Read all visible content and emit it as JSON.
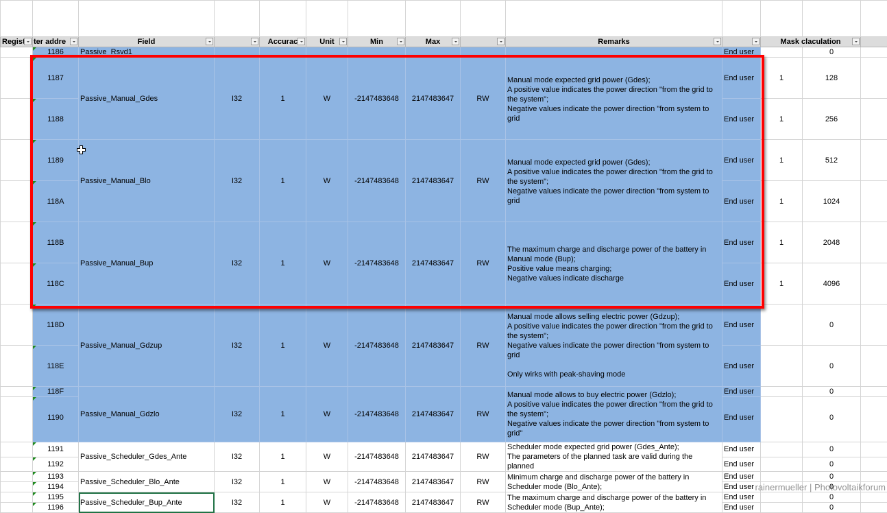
{
  "headers": [
    "Registe",
    "ter addre",
    "Field",
    "",
    "Accurac",
    "Unit",
    "Min",
    "Max",
    "",
    "Remarks",
    "",
    "Mask claculation"
  ],
  "groups": [
    {
      "field": "Passive_Rsvd1",
      "type": "",
      "acc": "",
      "unit": "",
      "min": "",
      "max": "",
      "rw": "",
      "remarks": "",
      "rows": [
        {
          "addr": "1186",
          "user": "End user",
          "m1": "",
          "m2": "0"
        }
      ]
    },
    {
      "field": "Passive_Manual_Gdes",
      "type": "I32",
      "acc": "1",
      "unit": "W",
      "min": "-2147483648",
      "max": "2147483647",
      "rw": "RW",
      "remarks": "Manual mode expected grid power (Gdes);\nA positive value indicates the power direction \"from the grid to the system\";\nNegative values indicate the power direction \"from system to grid",
      "rows": [
        {
          "addr": "1187",
          "user": "End user",
          "m1": "1",
          "m2": "128"
        },
        {
          "addr": "1188",
          "user": "End user",
          "m1": "1",
          "m2": "256"
        }
      ]
    },
    {
      "field": "Passive_Manual_Blo",
      "type": "I32",
      "acc": "1",
      "unit": "W",
      "min": "-2147483648",
      "max": "2147483647",
      "rw": "RW",
      "remarks": "Manual mode expected grid power (Gdes);\nA positive value indicates the power direction \"from the grid to the system\";\nNegative values indicate the power direction \"from system to grid",
      "rows": [
        {
          "addr": "1189",
          "user": "End user",
          "m1": "1",
          "m2": "512"
        },
        {
          "addr": "118A",
          "user": "End user",
          "m1": "1",
          "m2": "1024"
        }
      ]
    },
    {
      "field": "Passive_Manual_Bup",
      "type": "I32",
      "acc": "1",
      "unit": "W",
      "min": "-2147483648",
      "max": "2147483647",
      "rw": "RW",
      "remarks": "The maximum charge and discharge power of the battery in Manual mode (Bup);\nPositive value means charging;\nNegative values indicate discharge",
      "rows": [
        {
          "addr": "118B",
          "user": "End user",
          "m1": "1",
          "m2": "2048"
        },
        {
          "addr": "118C",
          "user": "End user",
          "m1": "1",
          "m2": "4096"
        }
      ]
    },
    {
      "field": "Passive_Manual_Gdzup",
      "type": "I32",
      "acc": "1",
      "unit": "W",
      "min": "-2147483648",
      "max": "2147483647",
      "rw": "RW",
      "remarks": "Manual mode allows selling electric power (Gdzup);\nA positive value indicates the power direction \"from the grid to the system\";\nNegative values indicate the power direction \"from system to grid\n\nOnly wirks with peak-shaving mode",
      "rows": [
        {
          "addr": "118D",
          "user": "End user",
          "m1": "",
          "m2": "0"
        },
        {
          "addr": "118E",
          "user": "End user",
          "m1": "",
          "m2": "0"
        }
      ]
    },
    {
      "field": "Passive_Manual_Gdzlo",
      "type": "I32",
      "acc": "1",
      "unit": "W",
      "min": "-2147483648",
      "max": "2147483647",
      "rw": "RW",
      "remarks": "Manual mode allows to buy electric power (Gdzlo);\nA positive value indicates the power direction \"from the grid to the system\";\nNegative values indicate the power direction \"from system to grid\"",
      "rows": [
        {
          "addr": "118F",
          "user": "End user",
          "m1": "",
          "m2": "0"
        },
        {
          "addr": "1190",
          "user": "End user",
          "m1": "",
          "m2": "0"
        }
      ]
    },
    {
      "field": "Passive_Scheduler_Gdes_Ante",
      "type": "I32",
      "acc": "1",
      "unit": "W",
      "min": "-2147483648",
      "max": "2147483647",
      "rw": "RW",
      "remarks": "Scheduler mode expected grid power (Gdes_Ante);\nThe parameters of the planned task are valid during the planned",
      "rows": [
        {
          "addr": "1191",
          "user": "End user",
          "m1": "",
          "m2": "0"
        },
        {
          "addr": "1192",
          "user": "End user",
          "m1": "",
          "m2": "0"
        }
      ]
    },
    {
      "field": "Passive_Scheduler_Blo_Ante",
      "type": "I32",
      "acc": "1",
      "unit": "W",
      "min": "-2147483648",
      "max": "2147483647",
      "rw": "RW",
      "remarks": "Minimum charge and discharge power of the battery in\nScheduler mode (Blo_Ante);",
      "rows": [
        {
          "addr": "1193",
          "user": "End user",
          "m1": "",
          "m2": "0"
        },
        {
          "addr": "1194",
          "user": "End user",
          "m1": "",
          "m2": "0"
        }
      ]
    },
    {
      "field": "Passive_Scheduler_Bup_Ante",
      "type": "I32",
      "acc": "1",
      "unit": "W",
      "min": "-2147483648",
      "max": "2147483647",
      "rw": "RW",
      "remarks": "The maximum charge and discharge power of the battery in\nScheduler mode (Bup_Ante);",
      "rows": [
        {
          "addr": "1195",
          "user": "End user",
          "m1": "",
          "m2": "0"
        },
        {
          "addr": "1196",
          "user": "End user",
          "m1": "",
          "m2": "0"
        }
      ]
    }
  ],
  "watermark": "rainermueller | Photovoltaikforum"
}
